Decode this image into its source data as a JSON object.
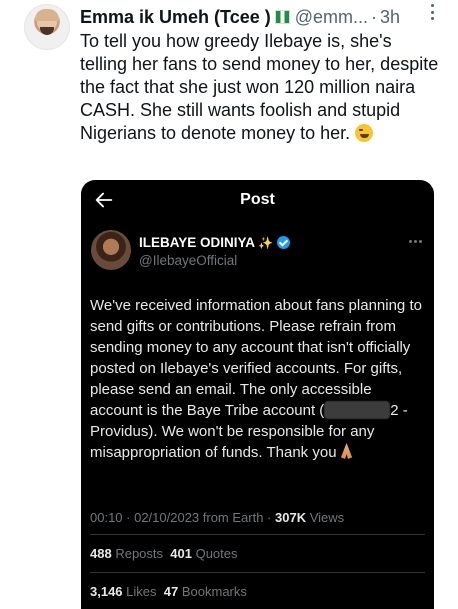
{
  "tweet": {
    "author_name": "Emma ik Umeh (Tcee )",
    "handle": "@emm...",
    "dot": "·",
    "time": "3h",
    "text": "To tell you how greedy Ilebaye is, she's telling her fans to send money to her, despite the fact that she just won 120 million naira CASH. She still wants foolish and stupid Nigerians to denote money to her."
  },
  "embedded_post": {
    "header_title": "Post",
    "author_name": "ILEBAYE ODINIYA",
    "sparkle": "✨",
    "handle": "@IlebayeOfficial",
    "text_before_redaction": "We've received information about fans planning to send gifts or contributions. Please refrain from sending money to any account that isn't officially posted on Ilebaye's verified accounts. For gifts, please send an email. The only accessible account is the Baye Tribe account (",
    "text_after_redaction": "2 - Providus). We won't be responsible for any misappropriation of funds. Thank you",
    "timestamp": "00:10 · 02/10/2023 from Earth ·",
    "views_count": "307K",
    "views_label": "Views",
    "reposts_count": "488",
    "reposts_label": "Reposts",
    "quotes_count": "401",
    "quotes_label": "Quotes",
    "likes_count": "3,146",
    "likes_label": "Likes",
    "bookmarks_count": "47",
    "bookmarks_label": "Bookmarks"
  },
  "icons": {
    "more": "more-icon",
    "back": "back-arrow-icon",
    "verified": "verified-icon",
    "flag": "nigeria-flag-icon",
    "emoji": "winking-face-icon",
    "pray": "folded-hands-icon"
  },
  "colors": {
    "accent": "#1d9bf0",
    "card_bg": "#000000",
    "secondary_text": "#536471"
  }
}
